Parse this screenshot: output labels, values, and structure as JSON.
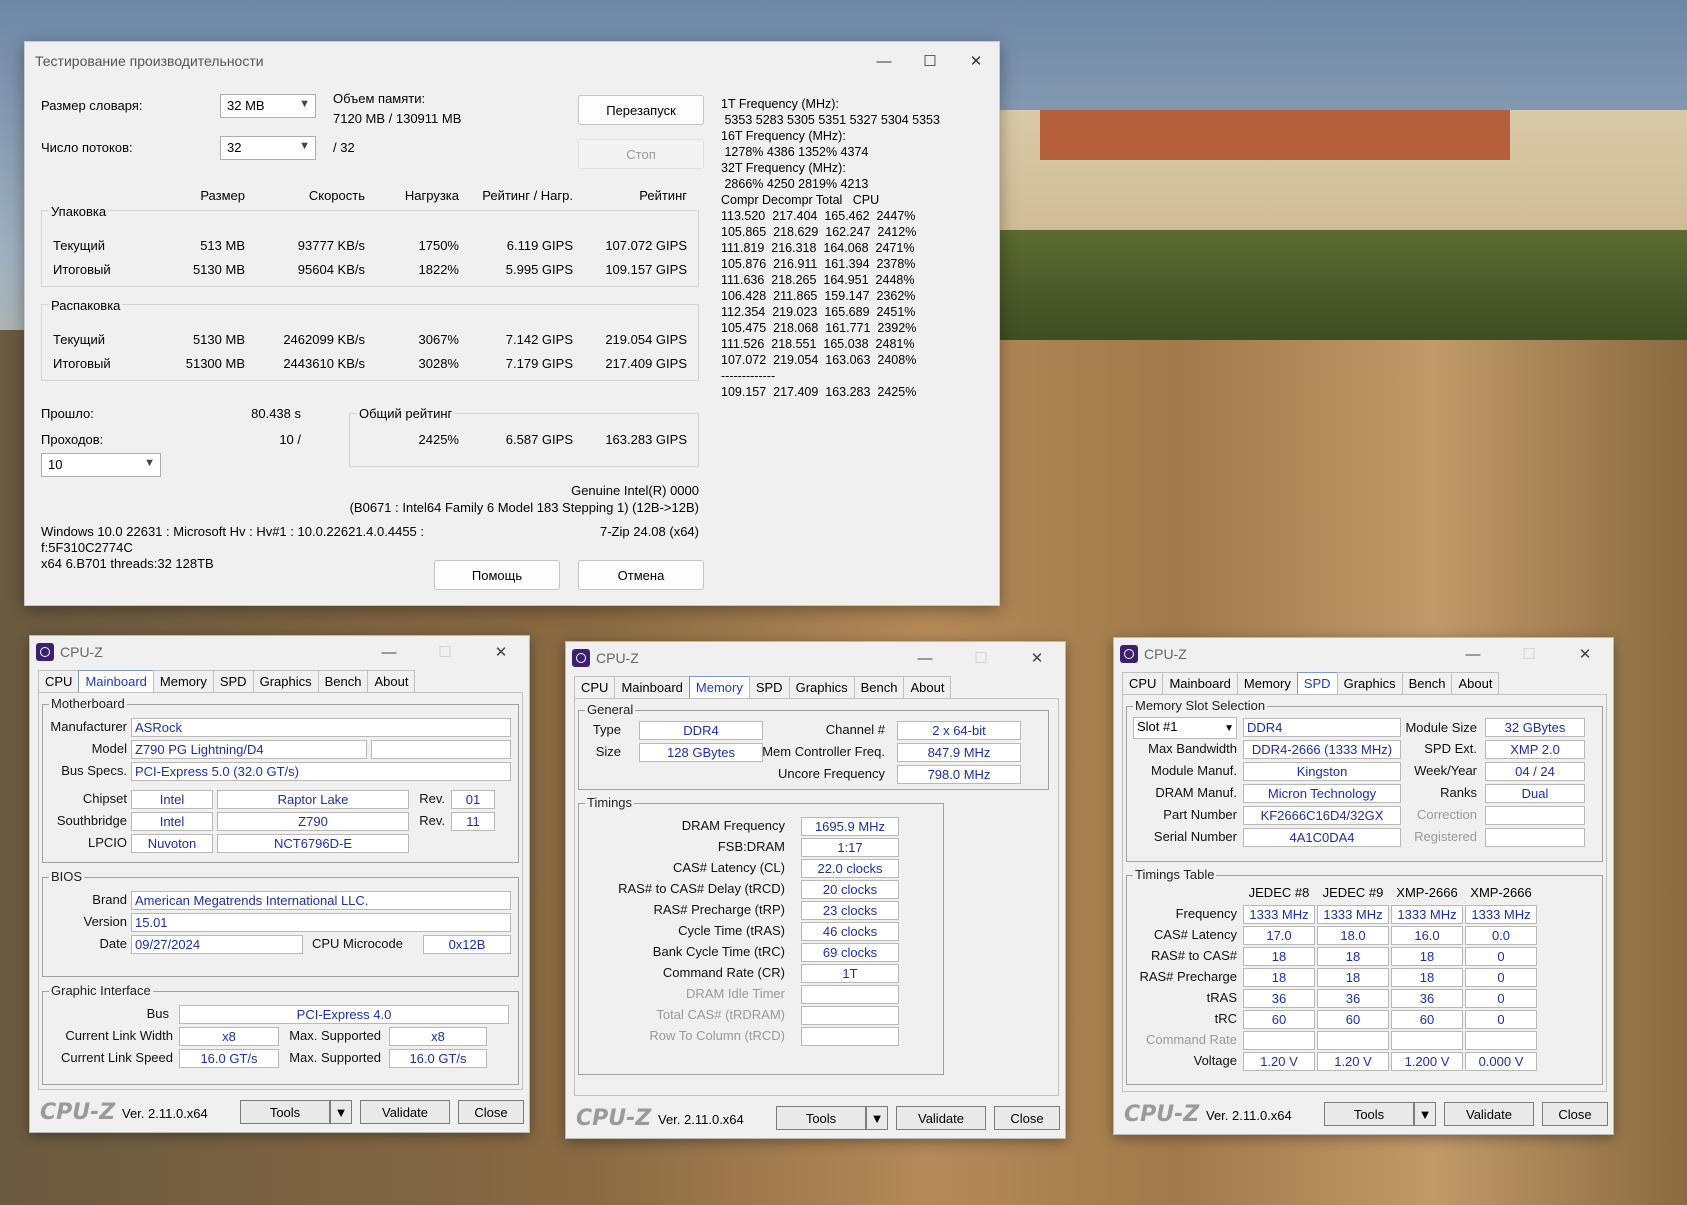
{
  "sevenzip": {
    "title": "Тестирование производительности",
    "dict_label": "Размер словаря:",
    "dict_value": "32 MB",
    "threads_label": "Число потоков:",
    "threads_value": "32",
    "threads_total": "/ 32",
    "mem_label": "Объем памяти:",
    "mem_value": "7120 MB / 130911 MB",
    "restart": "Перезапуск",
    "stop": "Стоп",
    "headers": [
      "Размер",
      "Скорость",
      "Нагрузка",
      "Рейтинг / Нагр.",
      "Рейтинг"
    ],
    "pack": {
      "title": "Упаковка",
      "rows": [
        {
          "label": "Текущий",
          "size": "513 MB",
          "speed": "93777 KB/s",
          "load": "1750%",
          "rpl": "6.119 GIPS",
          "rating": "107.072 GIPS"
        },
        {
          "label": "Итоговый",
          "size": "5130 MB",
          "speed": "95604 KB/s",
          "load": "1822%",
          "rpl": "5.995 GIPS",
          "rating": "109.157 GIPS"
        }
      ]
    },
    "unpack": {
      "title": "Распаковка",
      "rows": [
        {
          "label": "Текущий",
          "size": "5130 MB",
          "speed": "2462099 KB/s",
          "load": "3067%",
          "rpl": "7.142 GIPS",
          "rating": "219.054 GIPS"
        },
        {
          "label": "Итоговый",
          "size": "51300 MB",
          "speed": "2443610 KB/s",
          "load": "3028%",
          "rpl": "7.179 GIPS",
          "rating": "217.409 GIPS"
        }
      ]
    },
    "elapsed_label": "Прошло:",
    "elapsed": "80.438 s",
    "passes_label": "Проходов:",
    "passes": "10 /",
    "passes_sel": "10",
    "total_label": "Общий рейтинг",
    "total_load": "2425%",
    "total_rpl": "6.587 GIPS",
    "total_rating": "163.283 GIPS",
    "cpu1": "Genuine Intel(R) 0000",
    "cpu2": "(B0671 : Intel64 Family 6 Model 183 Stepping 1) (12B->12B)",
    "sys1": "Windows 10.0 22631 : Microsoft Hv : Hv#1 : 10.0.22621.4.0.4455 :",
    "sys2": "f:5F310C2774C",
    "sys3": "x64 6.B701 threads:32 128TB",
    "ver": "7-Zip 24.08 (x64)",
    "help": "Помощь",
    "cancel": "Отмена",
    "log": [
      "1T Frequency (MHz):",
      " 5353 5283 5305 5351 5327 5304 5353",
      "16T Frequency (MHz):",
      " 1278% 4386 1352% 4374",
      "32T Frequency (MHz):",
      " 2866% 4250 2819% 4213",
      "Compr Decompr Total   CPU",
      "113.520  217.404  165.462  2447%",
      "105.865  218.629  162.247  2412%",
      "111.819  216.318  164.068  2471%",
      "105.876  216.911  161.394  2378%",
      "111.636  218.265  164.951  2448%",
      "106.428  211.865  159.147  2362%",
      "112.354  219.023  165.689  2451%",
      "105.475  218.068  161.771  2392%",
      "111.526  218.551  165.038  2481%",
      "107.072  219.054  163.063  2408%",
      "-------------",
      "109.157  217.409  163.283  2425%"
    ]
  },
  "cpuz_common": {
    "title": "CPU-Z",
    "tabs": [
      "CPU",
      "Mainboard",
      "Memory",
      "SPD",
      "Graphics",
      "Bench",
      "About"
    ],
    "logo": "CPU-Z",
    "ver": "Ver. 2.11.0.x64",
    "tools": "Tools",
    "validate": "Validate",
    "close": "Close"
  },
  "mb": {
    "g_mb": "Motherboard",
    "manufacturer_l": "Manufacturer",
    "manufacturer": "ASRock",
    "model_l": "Model",
    "model": "Z790 PG Lightning/D4",
    "bus_l": "Bus Specs.",
    "bus": "PCI-Express 5.0 (32.0 GT/s)",
    "chipset_l": "Chipset",
    "chipset_v": "Intel",
    "chipset_n": "Raptor Lake",
    "rev_l": "Rev.",
    "chipset_rev": "01",
    "sb_l": "Southbridge",
    "sb_v": "Intel",
    "sb_n": "Z790",
    "sb_rev": "11",
    "lpcio_l": "LPCIO",
    "lpcio_v": "Nuvoton",
    "lpcio_n": "NCT6796D-E",
    "g_bios": "BIOS",
    "brand_l": "Brand",
    "brand": "American Megatrends International LLC.",
    "version_l": "Version",
    "version": "15.01",
    "date_l": "Date",
    "date": "09/27/2024",
    "micro_l": "CPU Microcode",
    "micro": "0x12B",
    "g_gi": "Graphic Interface",
    "gbus_l": "Bus",
    "gbus": "PCI-Express 4.0",
    "clw_l": "Current Link Width",
    "clw": "x8",
    "max_l": "Max. Supported",
    "mlw": "x8",
    "cls_l": "Current Link Speed",
    "cls": "16.0 GT/s",
    "mls": "16.0 GT/s"
  },
  "mem": {
    "g_gen": "General",
    "type_l": "Type",
    "type": "DDR4",
    "size_l": "Size",
    "size": "128 GBytes",
    "ch_l": "Channel #",
    "ch": "2 x 64-bit",
    "mcf_l": "Mem Controller Freq.",
    "mcf": "847.9 MHz",
    "uf_l": "Uncore Frequency",
    "uf": "798.0 MHz",
    "g_tim": "Timings",
    "rows": [
      {
        "l": "DRAM Frequency",
        "v": "1695.9 MHz"
      },
      {
        "l": "FSB:DRAM",
        "v": "1:17"
      },
      {
        "l": "CAS# Latency (CL)",
        "v": "22.0 clocks"
      },
      {
        "l": "RAS# to CAS# Delay (tRCD)",
        "v": "20 clocks"
      },
      {
        "l": "RAS# Precharge (tRP)",
        "v": "23 clocks"
      },
      {
        "l": "Cycle Time (tRAS)",
        "v": "46 clocks"
      },
      {
        "l": "Bank Cycle Time (tRC)",
        "v": "69 clocks"
      },
      {
        "l": "Command Rate (CR)",
        "v": "1T"
      },
      {
        "l": "DRAM Idle Timer",
        "v": ""
      },
      {
        "l": "Total CAS# (tRDRAM)",
        "v": ""
      },
      {
        "l": "Row To Column (tRCD)",
        "v": ""
      }
    ]
  },
  "spd": {
    "g_slot": "Memory Slot Selection",
    "slot": "Slot #1",
    "type": "DDR4",
    "msize_l": "Module Size",
    "msize": "32 GBytes",
    "bw_l": "Max Bandwidth",
    "bw": "DDR4-2666 (1333 MHz)",
    "ext_l": "SPD Ext.",
    "ext": "XMP 2.0",
    "mm_l": "Module Manuf.",
    "mm": "Kingston",
    "wy_l": "Week/Year",
    "wy": "04 / 24",
    "dm_l": "DRAM Manuf.",
    "dm": "Micron Technology",
    "ranks_l": "Ranks",
    "ranks": "Dual",
    "pn_l": "Part Number",
    "pn": "KF2666C16D4/32GX",
    "corr_l": "Correction",
    "sn_l": "Serial Number",
    "sn": "4A1C0DA4",
    "reg_l": "Registered",
    "g_tt": "Timings Table",
    "cols": [
      "JEDEC #8",
      "JEDEC #9",
      "XMP-2666",
      "XMP-2666"
    ],
    "rows": [
      {
        "l": "Frequency",
        "v": [
          "1333 MHz",
          "1333 MHz",
          "1333 MHz",
          "1333 MHz"
        ]
      },
      {
        "l": "CAS# Latency",
        "v": [
          "17.0",
          "18.0",
          "16.0",
          "0.0"
        ]
      },
      {
        "l": "RAS# to CAS#",
        "v": [
          "18",
          "18",
          "18",
          "0"
        ]
      },
      {
        "l": "RAS# Precharge",
        "v": [
          "18",
          "18",
          "18",
          "0"
        ]
      },
      {
        "l": "tRAS",
        "v": [
          "36",
          "36",
          "36",
          "0"
        ]
      },
      {
        "l": "tRC",
        "v": [
          "60",
          "60",
          "60",
          "0"
        ]
      },
      {
        "l": "Command Rate",
        "v": [
          "",
          "",
          "",
          ""
        ]
      },
      {
        "l": "Voltage",
        "v": [
          "1.20 V",
          "1.20 V",
          "1.200 V",
          "0.000 V"
        ]
      }
    ]
  }
}
